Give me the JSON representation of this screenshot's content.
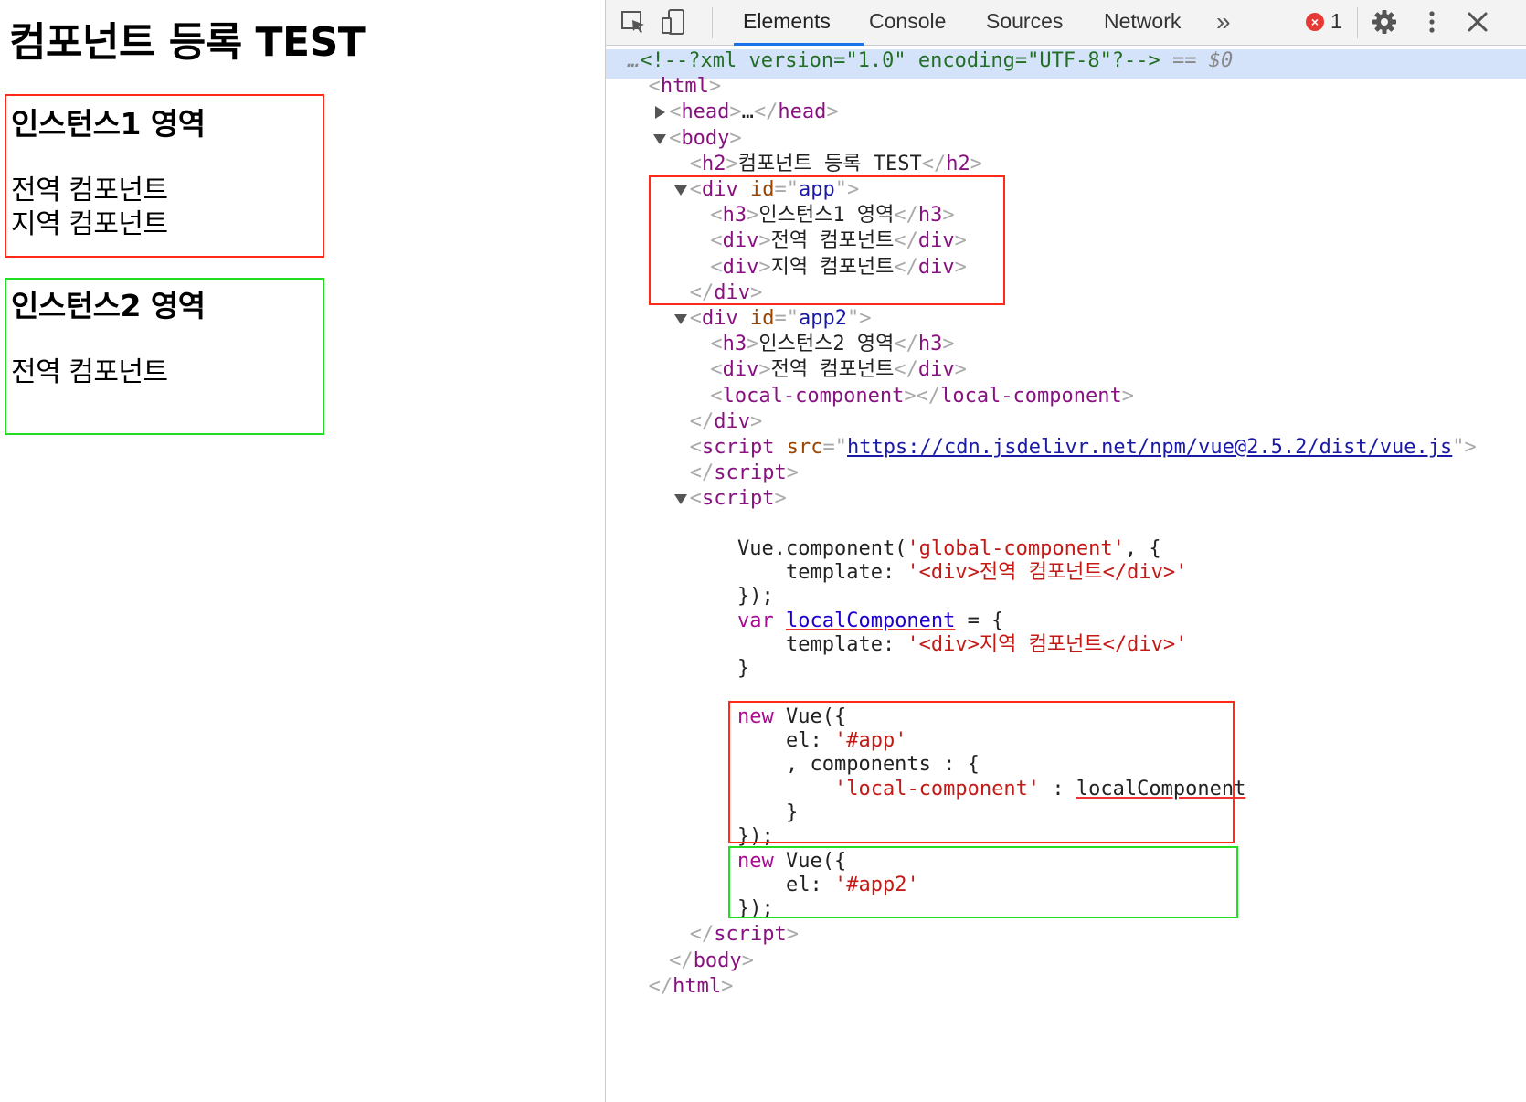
{
  "page": {
    "title": "컴포넌트 등록 TEST",
    "instance1": {
      "heading": "인스턴스1 영역",
      "lines": [
        "전역 컴포넌트",
        "지역 컴포넌트"
      ]
    },
    "instance2": {
      "heading": "인스턴스2 영역",
      "lines": [
        "전역 컴포넌트"
      ]
    }
  },
  "devtools": {
    "tabs": [
      "Elements",
      "Console",
      "Sources",
      "Network"
    ],
    "active_tab": "Elements",
    "more_icon": "»",
    "error_count": "1",
    "error_icon": "×",
    "icons": [
      "inspect-element-icon",
      "device-toolbar-icon",
      "more-tabs-icon",
      "error-icon",
      "settings-gear-icon",
      "kebab-menu-icon",
      "close-icon"
    ],
    "highlight_colors": {
      "red": "#ff2a1a",
      "green": "#22dd22",
      "selection": "#d4e3fa"
    },
    "lines": [
      {
        "indent": 0,
        "tri": "",
        "parts": [
          [
            "dim",
            "…"
          ],
          [
            "com",
            "<!--?xml version=\"1.0\" encoding=\"UTF-8\"?-->"
          ],
          [
            "dim",
            " == "
          ],
          [
            "dim",
            "$0"
          ]
        ]
      },
      {
        "indent": 1,
        "tri": "",
        "parts": [
          [
            "br",
            "<"
          ],
          [
            "tag",
            "html"
          ],
          [
            "br",
            ">"
          ]
        ]
      },
      {
        "indent": 2,
        "tri": "right",
        "parts": [
          [
            "br",
            "<"
          ],
          [
            "tag",
            "head"
          ],
          [
            "br",
            ">"
          ],
          [
            "txt",
            "…"
          ],
          [
            "br",
            "</"
          ],
          [
            "tag",
            "head"
          ],
          [
            "br",
            ">"
          ]
        ]
      },
      {
        "indent": 2,
        "tri": "down",
        "parts": [
          [
            "br",
            "<"
          ],
          [
            "tag",
            "body"
          ],
          [
            "br",
            ">"
          ]
        ]
      },
      {
        "indent": 3,
        "tri": "",
        "parts": [
          [
            "br",
            "<"
          ],
          [
            "tag",
            "h2"
          ],
          [
            "br",
            ">"
          ],
          [
            "txt",
            "컴포넌트 등록 TEST"
          ],
          [
            "br",
            "</"
          ],
          [
            "tag",
            "h2"
          ],
          [
            "br",
            ">"
          ]
        ]
      },
      {
        "indent": 3,
        "tri": "down",
        "parts": [
          [
            "br",
            "<"
          ],
          [
            "tag",
            "div"
          ],
          [
            "txt",
            " "
          ],
          [
            "attr",
            "id"
          ],
          [
            "br",
            "=\""
          ],
          [
            "val",
            "app"
          ],
          [
            "br",
            "\">"
          ]
        ]
      },
      {
        "indent": 4,
        "tri": "",
        "parts": [
          [
            "br",
            "<"
          ],
          [
            "tag",
            "h3"
          ],
          [
            "br",
            ">"
          ],
          [
            "txt",
            "인스턴스1 영역"
          ],
          [
            "br",
            "</"
          ],
          [
            "tag",
            "h3"
          ],
          [
            "br",
            ">"
          ]
        ]
      },
      {
        "indent": 4,
        "tri": "",
        "parts": [
          [
            "br",
            "<"
          ],
          [
            "tag",
            "div"
          ],
          [
            "br",
            ">"
          ],
          [
            "txt",
            "전역 컴포넌트"
          ],
          [
            "br",
            "</"
          ],
          [
            "tag",
            "div"
          ],
          [
            "br",
            ">"
          ]
        ]
      },
      {
        "indent": 4,
        "tri": "",
        "parts": [
          [
            "br",
            "<"
          ],
          [
            "tag",
            "div"
          ],
          [
            "br",
            ">"
          ],
          [
            "txt",
            "지역 컴포넌트"
          ],
          [
            "br",
            "</"
          ],
          [
            "tag",
            "div"
          ],
          [
            "br",
            ">"
          ]
        ]
      },
      {
        "indent": 3,
        "tri": "",
        "parts": [
          [
            "br",
            "</"
          ],
          [
            "tag",
            "div"
          ],
          [
            "br",
            ">"
          ]
        ]
      },
      {
        "indent": 3,
        "tri": "down",
        "parts": [
          [
            "br",
            "<"
          ],
          [
            "tag",
            "div"
          ],
          [
            "txt",
            " "
          ],
          [
            "attr",
            "id"
          ],
          [
            "br",
            "=\""
          ],
          [
            "val",
            "app2"
          ],
          [
            "br",
            "\">"
          ]
        ]
      },
      {
        "indent": 4,
        "tri": "",
        "parts": [
          [
            "br",
            "<"
          ],
          [
            "tag",
            "h3"
          ],
          [
            "br",
            ">"
          ],
          [
            "txt",
            "인스턴스2 영역"
          ],
          [
            "br",
            "</"
          ],
          [
            "tag",
            "h3"
          ],
          [
            "br",
            ">"
          ]
        ]
      },
      {
        "indent": 4,
        "tri": "",
        "parts": [
          [
            "br",
            "<"
          ],
          [
            "tag",
            "div"
          ],
          [
            "br",
            ">"
          ],
          [
            "txt",
            "전역 컴포넌트"
          ],
          [
            "br",
            "</"
          ],
          [
            "tag",
            "div"
          ],
          [
            "br",
            ">"
          ]
        ]
      },
      {
        "indent": 4,
        "tri": "",
        "parts": [
          [
            "br",
            "<"
          ],
          [
            "tag",
            "local-component"
          ],
          [
            "br",
            "></"
          ],
          [
            "tag",
            "local-component"
          ],
          [
            "br",
            ">"
          ]
        ]
      },
      {
        "indent": 3,
        "tri": "",
        "parts": [
          [
            "br",
            "</"
          ],
          [
            "tag",
            "div"
          ],
          [
            "br",
            ">"
          ]
        ]
      },
      {
        "indent": 3,
        "tri": "",
        "parts": [
          [
            "br",
            "<"
          ],
          [
            "tag",
            "script"
          ],
          [
            "txt",
            " "
          ],
          [
            "attr",
            "src"
          ],
          [
            "br",
            "=\""
          ],
          [
            "link",
            "https://cdn.jsdelivr.net/npm/vue@2.5.2/dist/vue.js"
          ],
          [
            "br",
            "\">"
          ]
        ]
      },
      {
        "indent": 3,
        "tri": "",
        "parts": [
          [
            "br",
            "</"
          ],
          [
            "tag",
            "script"
          ],
          [
            "br",
            ">"
          ]
        ]
      },
      {
        "indent": 3,
        "tri": "down",
        "parts": [
          [
            "br",
            "<"
          ],
          [
            "tag",
            "script"
          ],
          [
            "br",
            ">"
          ]
        ]
      }
    ],
    "script_lines": [
      [
        [
          "txt",
          "Vue.component("
        ],
        [
          "str",
          "'global-component'"
        ],
        [
          "txt",
          ", {"
        ]
      ],
      [
        [
          "txt",
          "    template: "
        ],
        [
          "str",
          "'<div>전역 컴포넌트</div>'"
        ]
      ],
      [
        [
          "txt",
          "});"
        ]
      ],
      [
        [
          "kw",
          "var "
        ],
        [
          "var",
          "localComponent"
        ],
        [
          "txt",
          " = {"
        ]
      ],
      [
        [
          "txt",
          "    template: "
        ],
        [
          "str",
          "'<div>지역 컴포넌트</div>'"
        ]
      ],
      [
        [
          "txt",
          "}"
        ]
      ],
      [
        [
          "txt",
          ""
        ]
      ],
      [
        [
          "kw",
          "new "
        ],
        [
          "txt",
          "Vue({"
        ]
      ],
      [
        [
          "txt",
          "    el: "
        ],
        [
          "str",
          "'#app'"
        ]
      ],
      [
        [
          "txt",
          "    , components : {"
        ]
      ],
      [
        [
          "txt",
          "        "
        ],
        [
          "str",
          "'local-component'"
        ],
        [
          "txt",
          " : "
        ],
        [
          "under",
          "localComponent"
        ]
      ],
      [
        [
          "txt",
          "    }"
        ]
      ],
      [
        [
          "txt",
          "});"
        ]
      ],
      [
        [
          "kw",
          "new "
        ],
        [
          "txt",
          "Vue({"
        ]
      ],
      [
        [
          "txt",
          "    el: "
        ],
        [
          "str",
          "'#app2'"
        ]
      ],
      [
        [
          "txt",
          "});"
        ]
      ]
    ],
    "closing_lines": [
      {
        "indent": 3,
        "parts": [
          [
            "br",
            "</"
          ],
          [
            "tag",
            "script"
          ],
          [
            "br",
            ">"
          ]
        ]
      },
      {
        "indent": 2,
        "parts": [
          [
            "br",
            "</"
          ],
          [
            "tag",
            "body"
          ],
          [
            "br",
            ">"
          ]
        ]
      },
      {
        "indent": 1,
        "parts": [
          [
            "br",
            "</"
          ],
          [
            "tag",
            "html"
          ],
          [
            "br",
            ">"
          ]
        ]
      }
    ]
  }
}
